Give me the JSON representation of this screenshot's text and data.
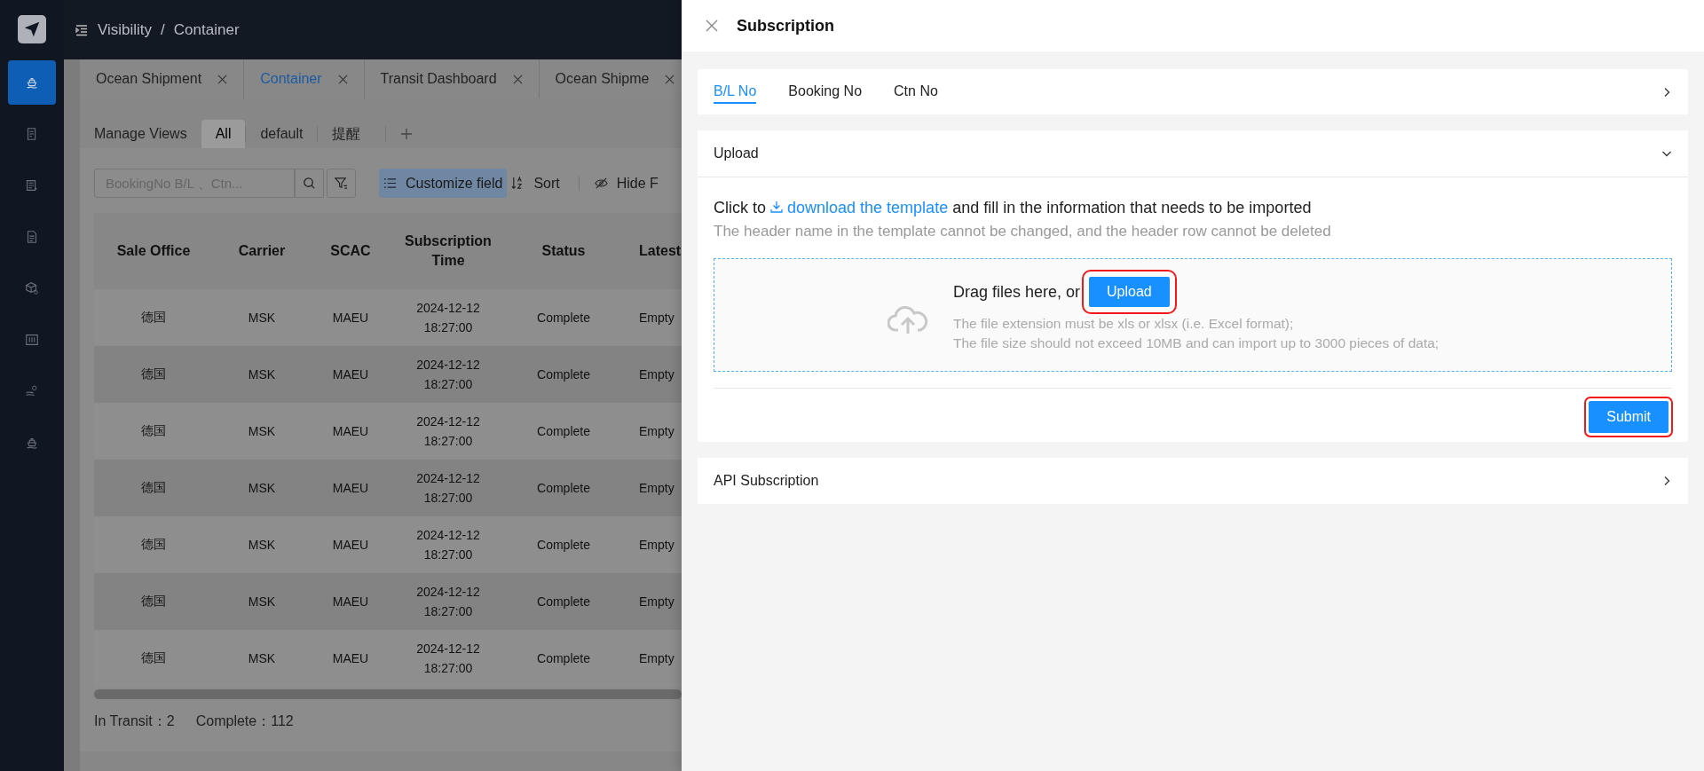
{
  "topbar": {
    "breadcrumb": [
      "Visibility",
      "Container"
    ],
    "separator": "/"
  },
  "sidebar": {
    "items": [
      {
        "selected": true
      },
      {
        "selected": false
      },
      {
        "selected": false
      },
      {
        "selected": false
      },
      {
        "selected": false
      },
      {
        "selected": false
      },
      {
        "selected": false
      },
      {
        "selected": false
      }
    ]
  },
  "page_tabs": [
    {
      "label": "Ocean Shipment",
      "selected": false
    },
    {
      "label": "Container",
      "selected": true
    },
    {
      "label": "Transit Dashboard",
      "selected": false
    },
    {
      "label": "Ocean Shipme",
      "selected": false
    }
  ],
  "views": {
    "label": "Manage Views",
    "tabs": [
      {
        "label": "All",
        "selected": true
      },
      {
        "label": "default",
        "selected": false
      },
      {
        "label": "提醒",
        "selected": false
      }
    ]
  },
  "toolbar": {
    "search_placeholder": "BookingNo B/L 、Ctn...",
    "buttons": [
      {
        "kind": "list",
        "label": "Customize field",
        "selected": true
      },
      {
        "kind": "sort",
        "label": "Sort",
        "selected": false
      },
      {
        "kind": "hide",
        "label": "Hide F",
        "selected": false
      }
    ]
  },
  "table": {
    "columns": [
      "Sale Office",
      "Carrier",
      "SCAC",
      "Subscription Time",
      "Status",
      "Latest"
    ],
    "rows": [
      [
        "德国",
        "MSK",
        "MAEU",
        "2024-12-12 18:27:00",
        "Complete",
        "Empty"
      ],
      [
        "德国",
        "MSK",
        "MAEU",
        "2024-12-12 18:27:00",
        "Complete",
        "Empty"
      ],
      [
        "德国",
        "MSK",
        "MAEU",
        "2024-12-12 18:27:00",
        "Complete",
        "Empty"
      ],
      [
        "德国",
        "MSK",
        "MAEU",
        "2024-12-12 18:27:00",
        "Complete",
        "Empty"
      ],
      [
        "德国",
        "MSK",
        "MAEU",
        "2024-12-12 18:27:00",
        "Complete",
        "Empty"
      ],
      [
        "德国",
        "MSK",
        "MAEU",
        "2024-12-12 18:27:00",
        "Complete",
        "Empty"
      ],
      [
        "德国",
        "MSK",
        "MAEU",
        "2024-12-12 18:27:00",
        "Complete",
        "Empty"
      ]
    ]
  },
  "summary": [
    {
      "label": "In Transit：",
      "value": "2"
    },
    {
      "label": "Complete：",
      "value": "112"
    }
  ],
  "drawer": {
    "title": "Subscription",
    "tabs": [
      {
        "label": "B/L No",
        "selected": true
      },
      {
        "label": "Booking No",
        "selected": false
      },
      {
        "label": "Ctn No",
        "selected": false
      }
    ],
    "upload": {
      "title": "Upload",
      "expanded": true,
      "instruction": {
        "before": "Click to",
        "link": "download the template",
        "after": "and fill in the information that needs to be imported"
      },
      "note": "The header name in the template cannot be changed, and the header row cannot be deleted",
      "dropzone": {
        "prompt": "Drag files here, or",
        "button": {
          "label": "Upload",
          "highlighted": true
        },
        "hints": [
          "The file extension must be xls or xlsx (i.e. Excel format);",
          "The file size should not exceed 10MB and can import up to 3000 pieces of data;"
        ]
      },
      "submit": {
        "label": "Submit",
        "highlighted": true
      }
    },
    "api": {
      "title": "API Subscription",
      "expanded": false
    }
  }
}
